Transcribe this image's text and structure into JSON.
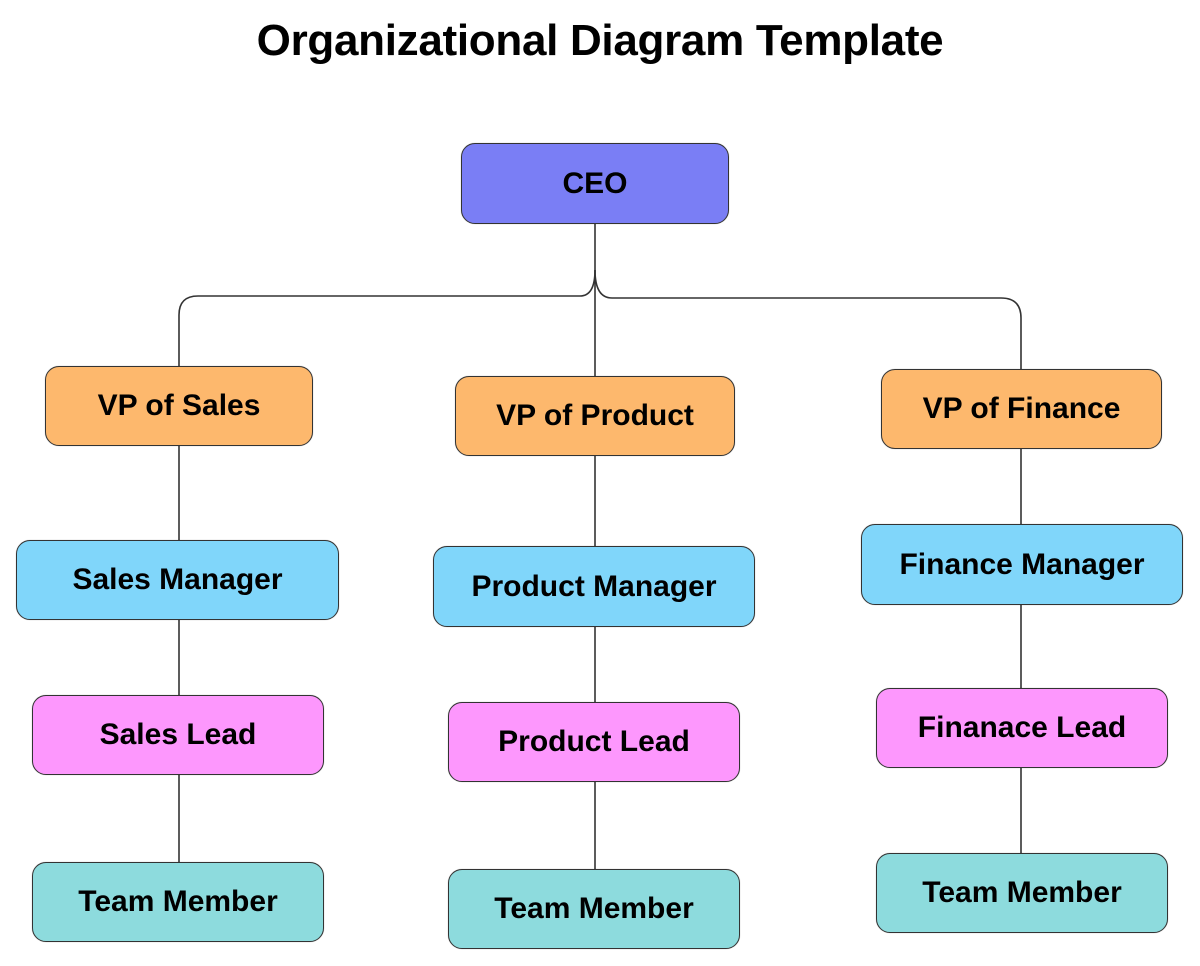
{
  "title": "Organizational Diagram Template",
  "colors": {
    "ceo": "#7a7ef5",
    "vp": "#fdb86d",
    "manager": "#80d6fa",
    "lead": "#fd97fd",
    "member": "#8ddbdd",
    "line": "#333333"
  },
  "ceo": {
    "label": "CEO"
  },
  "departments": [
    {
      "name": "sales",
      "vp": "VP of Sales",
      "manager": "Sales Manager",
      "lead": "Sales Lead",
      "member": "Team Member"
    },
    {
      "name": "product",
      "vp": "VP of Product",
      "manager": "Product Manager",
      "lead": "Product Lead",
      "member": "Team Member"
    },
    {
      "name": "finance",
      "vp": "VP of Finance",
      "manager": "Finance Manager",
      "lead": "Finanace Lead",
      "member": "Team Member"
    }
  ]
}
